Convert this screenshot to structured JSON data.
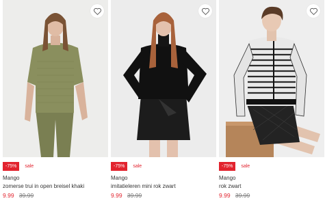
{
  "colors": {
    "sale_red": "#e2232e",
    "text": "#333333",
    "old_price": "#777777"
  },
  "products": [
    {
      "discount": "-75%",
      "sale_label": "sale",
      "brand": "Mango",
      "name": "zomerse trui in open breisel khaki",
      "price_now": "9.99",
      "price_old": "39.99",
      "favorite_icon": "heart-outline-icon"
    },
    {
      "discount": "-75%",
      "sale_label": "sale",
      "brand": "Mango",
      "name": "imitatieleren mini rok zwart",
      "price_now": "9.99",
      "price_old": "39.99",
      "favorite_icon": "heart-outline-icon"
    },
    {
      "discount": "-75%",
      "sale_label": "sale",
      "brand": "Mango",
      "name": "rok zwart",
      "price_now": "9.99",
      "price_old": "39.99",
      "favorite_icon": "heart-outline-icon"
    }
  ]
}
